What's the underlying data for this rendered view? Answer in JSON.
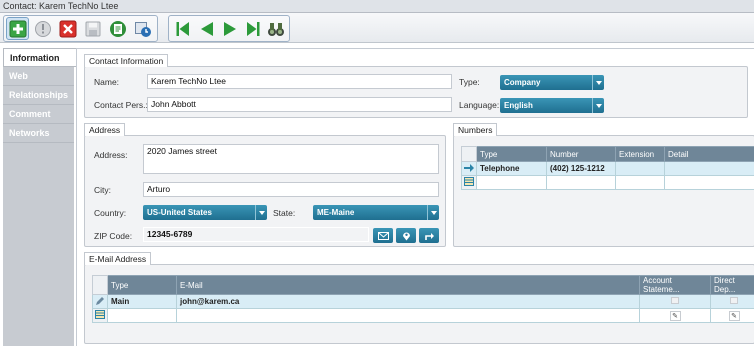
{
  "window": {
    "title": "Contact: Karem TechNo Ltee"
  },
  "toolbar": {
    "buttons": [
      "add-icon",
      "info-icon",
      "delete-icon",
      "save-icon",
      "notes-icon",
      "history-icon"
    ],
    "nav": [
      "first-icon",
      "previous-icon",
      "next-icon",
      "last-icon",
      "binoculars-icon"
    ]
  },
  "sidebar": {
    "items": [
      {
        "label": "Information"
      },
      {
        "label": "Web"
      },
      {
        "label": "Relationships"
      },
      {
        "label": "Comment"
      },
      {
        "label": "Networks"
      }
    ]
  },
  "contact": {
    "section_label": "Contact Information",
    "name_label": "Name:",
    "name_value": "Karem TechNo Ltee",
    "contact_label": "Contact Pers.:",
    "contact_value": "John Abbott",
    "type_label": "Type:",
    "type_value": "Company",
    "language_label": "Language:",
    "language_value": "English"
  },
  "address": {
    "section_label": "Address",
    "address_label": "Address:",
    "address_value": "2020 James street",
    "city_label": "City:",
    "city_value": "Arturo",
    "country_label": "Country:",
    "country_value": "US-United States",
    "state_label": "State:",
    "state_value": "ME-Maine",
    "zip_label": "ZIP Code:",
    "zip_value": "12345-6789"
  },
  "numbers": {
    "section_label": "Numbers",
    "columns": [
      "Type",
      "Number",
      "Extension",
      "Detail"
    ],
    "rows": [
      {
        "type": "Telephone",
        "number": "(402) 125-1212",
        "extension": "",
        "detail": ""
      }
    ]
  },
  "email": {
    "section_label": "E-Mail Address",
    "columns": [
      "Type",
      "E-Mail",
      "Account Stateme...",
      "Direct Dep..."
    ],
    "rows": [
      {
        "type": "Main",
        "email": "john@karem.ca"
      }
    ]
  },
  "colors": {
    "accent": "#2a84a8",
    "grid_header": "#6f8698",
    "selected_row": "#d9edf6"
  }
}
